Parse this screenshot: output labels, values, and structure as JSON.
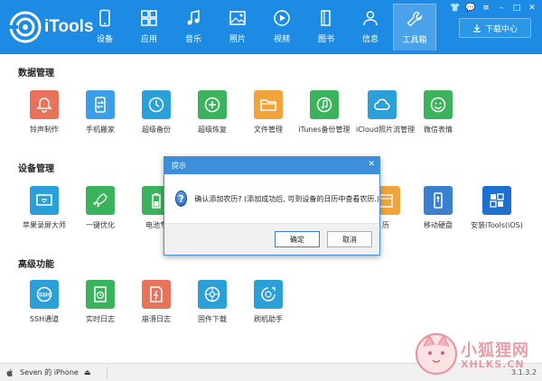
{
  "app": {
    "name": "iTools"
  },
  "nav": [
    {
      "label": "设备",
      "icon": "phone-icon"
    },
    {
      "label": "应用",
      "icon": "apps-icon"
    },
    {
      "label": "音乐",
      "icon": "music-icon"
    },
    {
      "label": "照片",
      "icon": "photo-icon"
    },
    {
      "label": "视频",
      "icon": "video-icon"
    },
    {
      "label": "图书",
      "icon": "book-icon"
    },
    {
      "label": "信息",
      "icon": "person-icon"
    },
    {
      "label": "工具箱",
      "icon": "wrench-icon"
    }
  ],
  "active_nav": "工具箱",
  "download_center": {
    "label": "下载中心",
    "icon": "download-icon"
  },
  "sections": {
    "data": {
      "title": "数据管理",
      "items": [
        {
          "label": "铃声制作",
          "icon": "bell-icon",
          "color": "#e8735a"
        },
        {
          "label": "手机搬家",
          "icon": "phone-transfer-icon",
          "color": "#3b9ee6"
        },
        {
          "label": "超级备份",
          "icon": "clock-backup-icon",
          "color": "#2a9fd8"
        },
        {
          "label": "超级恢复",
          "icon": "restore-icon",
          "color": "#3ab35c"
        },
        {
          "label": "文件管理",
          "icon": "folder-icon",
          "color": "#f0a43a"
        },
        {
          "label": "iTunes备份管理",
          "icon": "itunes-backup-icon",
          "color": "#3ab35c"
        },
        {
          "label": "iCloud照片流管理",
          "icon": "cloud-icon",
          "color": "#2a9fd8"
        },
        {
          "label": "微信表情",
          "icon": "wechat-emoji-icon",
          "color": "#3ab35c"
        }
      ]
    },
    "device": {
      "title": "设备管理",
      "items": [
        {
          "label": "苹果录屏大师",
          "icon": "screen-record-icon",
          "color": "#2a9fd8"
        },
        {
          "label": "一键优化",
          "icon": "rocket-icon",
          "color": "#3ab35c"
        },
        {
          "label": "电池专",
          "icon": "battery-icon",
          "color": "#3ab35c"
        },
        {
          "label": "历",
          "icon": "calendar-icon",
          "color": "#f0a43a"
        },
        {
          "label": "移动硬盘",
          "icon": "usb-drive-icon",
          "color": "#3b7fd0"
        },
        {
          "label": "安装iTools(iOS)",
          "icon": "itools-ios-icon",
          "color": "#1d6fd0"
        }
      ]
    },
    "advanced": {
      "title": "高级功能",
      "items": [
        {
          "label": "SSH通道",
          "icon": "ssh-icon",
          "color": "#2a9fd8"
        },
        {
          "label": "实时日志",
          "icon": "log-icon",
          "color": "#3ab35c"
        },
        {
          "label": "崩溃日志",
          "icon": "crash-log-icon",
          "color": "#e8735a"
        },
        {
          "label": "固件下载",
          "icon": "gear-icon",
          "color": "#2a9fd8"
        },
        {
          "label": "刷机助手",
          "icon": "flash-icon",
          "color": "#2a9fd8"
        }
      ]
    }
  },
  "dialog": {
    "title": "提示",
    "message": "确认添加农历? (添加成功后, 可到设备的日历中查看农历.)",
    "ok_label": "确定",
    "cancel_label": "取消"
  },
  "statusbar": {
    "device": "Seven 的 iPhone",
    "version": "3.1.3.2"
  },
  "watermark": {
    "text_cn": "小狐狸网",
    "text_en": "XHLKS.CN"
  }
}
